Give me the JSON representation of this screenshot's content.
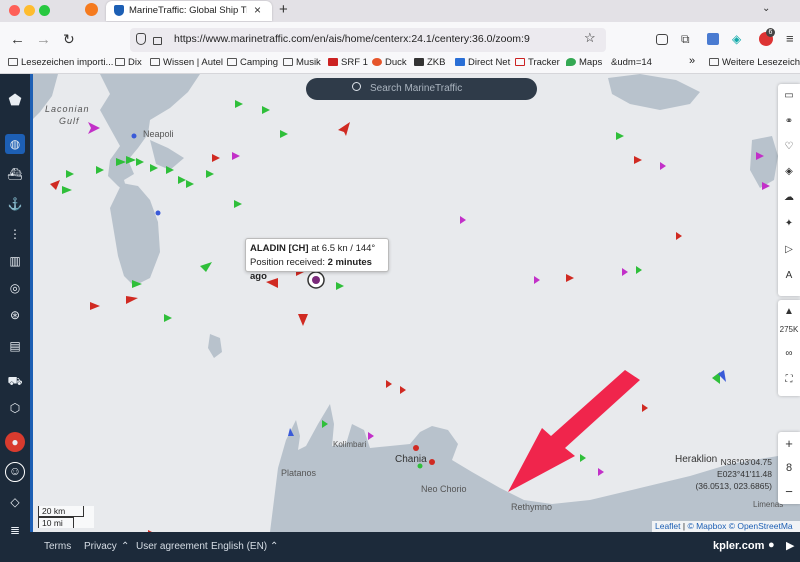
{
  "browser": {
    "tab_title": "MarineTraffic: Global Ship Track",
    "url": "https://www.marinetraffic.com/en/ais/home/centerx:24.1/centery:36.0/zoom:9",
    "profile_badge": "6",
    "bookmarks": [
      "Lesezeichen importi...",
      "Dix",
      "Wissen | Autel",
      "Camping",
      "Musik",
      "SRF 1",
      "Duck",
      "ZKB",
      "Direct Net",
      "Tracker",
      "Maps",
      "&udm=14"
    ],
    "bookmarks_overflow": "»",
    "other_bookmarks": "Weitere Lesezeichen"
  },
  "search": {
    "placeholder": "Search MarineTraffic"
  },
  "tooltip": {
    "vessel": "ALADIN [CH]",
    "speed_text": " at 6.5 kn / 144°",
    "position_label": "Position received: ",
    "time": "2 minutes ago"
  },
  "map_labels": {
    "laconian": "Laconian",
    "gulf": "Gulf",
    "neapoli": "Neapoli",
    "kolimbari": "Kolimbari",
    "platanos": "Platanos",
    "chania": "Chania",
    "neo_chorio": "Neo Chorio",
    "rethymno": "Rethymno",
    "heraklion": "Heraklion",
    "limenas": "Limenas"
  },
  "right_controls": {
    "traffic_count": "275K",
    "zoom_level": "8",
    "zoom_in": "+",
    "zoom_out": "−"
  },
  "coords": {
    "lat": "N36°03'04.75",
    "lon": "E023°41'11.48",
    "decimal": "(36.0513, 023.6865)"
  },
  "scale": {
    "km": "20 km",
    "mi": "10 mi"
  },
  "attribution": {
    "leaflet": "Leaflet",
    "mapbox": "© Mapbox",
    "osm": "© OpenStreetMa"
  },
  "footer": {
    "terms": "Terms",
    "privacy": "Privacy",
    "user_agreement": "User agreement",
    "language": "English (EN)",
    "brand": "kpler.com"
  },
  "colors": {
    "sidebar": "#1c2a3a",
    "land": "#b8c2cc",
    "sea": "#e8eaed",
    "cargo": "#2fbf3a",
    "tanker": "#d02a22",
    "passenger": "#3a5ad8",
    "pleasure": "#c230c8",
    "highlight_arrow": "#f0254c"
  }
}
